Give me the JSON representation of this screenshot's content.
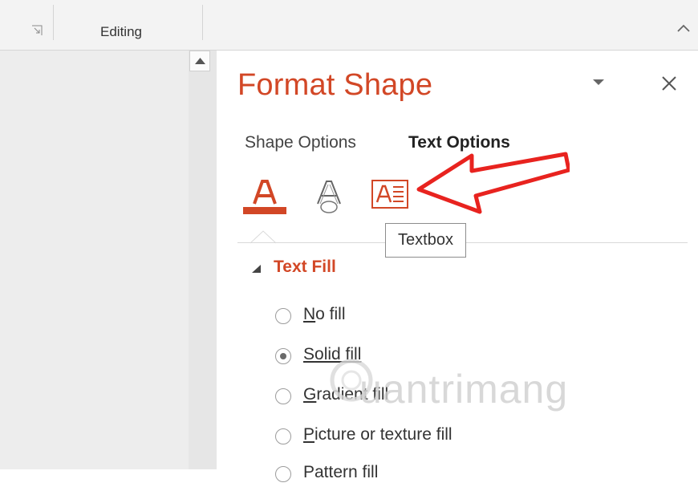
{
  "ribbon": {
    "group_label": "Editing"
  },
  "pane": {
    "title": "Format Shape",
    "tabs": [
      {
        "label": "Shape Options",
        "active": false
      },
      {
        "label": "Text Options",
        "active": true
      }
    ],
    "icons": [
      {
        "name": "text-fill-outline-icon",
        "active": true
      },
      {
        "name": "text-effects-icon",
        "active": false
      },
      {
        "name": "textbox-icon",
        "active": false
      }
    ],
    "tooltip": "Textbox",
    "section": {
      "title": "Text Fill",
      "expanded": true
    },
    "fill_options": [
      {
        "pre": "",
        "key": "N",
        "post": "o fill",
        "checked": false
      },
      {
        "pre": "",
        "key": "S",
        "post": "olid fill",
        "checked": true
      },
      {
        "pre": "",
        "key": "G",
        "post": "radient fill",
        "checked": false
      },
      {
        "pre": "",
        "key": "P",
        "post": "icture or texture fill",
        "checked": false
      },
      {
        "pre": "",
        "key": "",
        "post": "Pattern fill",
        "checked": false
      }
    ]
  },
  "colors": {
    "accent": "#d24726",
    "arrow": "#e8231f"
  },
  "watermark": "uantrimang"
}
